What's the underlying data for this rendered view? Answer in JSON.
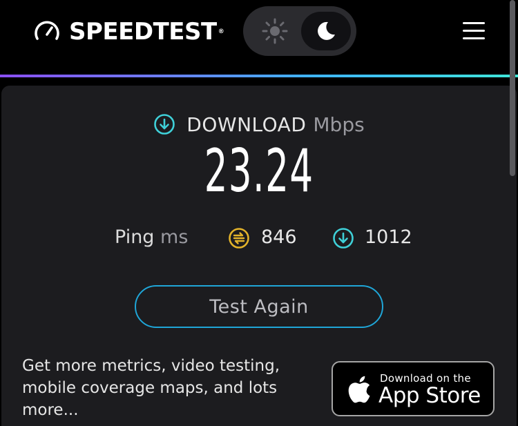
{
  "header": {
    "brand": "SPEEDTEST",
    "trademark": "®",
    "theme_light_icon": "sun-icon",
    "theme_dark_icon": "moon-icon",
    "menu_icon": "hamburger-icon"
  },
  "result": {
    "download_label": "DOWNLOAD",
    "download_unit": "Mbps",
    "download_value": "23.24",
    "ping_label": "Ping",
    "ping_unit": "ms",
    "jitter_value": "846",
    "ping_download_value": "1012"
  },
  "actions": {
    "test_again": "Test Again"
  },
  "promo": {
    "text": "Get more metrics, video testing, mobile coverage maps, and lots more...",
    "app_store_small": "Download on the",
    "app_store_big": "App Store"
  },
  "colors": {
    "accent_cyan": "#3fd0d8",
    "accent_yellow": "#e3b32a",
    "button_border": "#1fa6d8"
  }
}
